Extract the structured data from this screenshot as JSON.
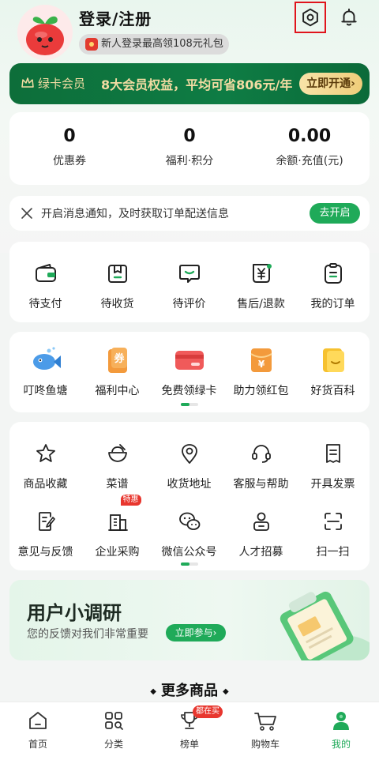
{
  "header": {
    "login_title": "登录/注册",
    "gift_text": "新人登录最高领108元礼包"
  },
  "vip": {
    "name": "绿卡会员",
    "desc": "8大会员权益，平均可省806元/年",
    "button": "立即开通›"
  },
  "stats": [
    {
      "value": "0",
      "label": "优惠券"
    },
    {
      "value": "0",
      "label": "福利·积分"
    },
    {
      "value": "0.00",
      "label": "余额·充值(元)"
    }
  ],
  "notice": {
    "text": "开启消息通知，及时获取订单配送信息",
    "button": "去开启"
  },
  "orders": [
    {
      "label": "待支付",
      "icon": "wallet-icon"
    },
    {
      "label": "待收货",
      "icon": "package-icon"
    },
    {
      "label": "待评价",
      "icon": "comment-icon"
    },
    {
      "label": "售后/退款",
      "icon": "refund-icon"
    },
    {
      "label": "我的订单",
      "icon": "order-list-icon"
    }
  ],
  "features": [
    {
      "label": "叮咚鱼塘",
      "icon": "fish-icon"
    },
    {
      "label": "福利中心",
      "icon": "coupon-icon"
    },
    {
      "label": "免费领绿卡",
      "icon": "card-icon"
    },
    {
      "label": "助力领红包",
      "icon": "red-packet-icon"
    },
    {
      "label": "好货百科",
      "icon": "book-icon"
    }
  ],
  "services": {
    "row1": [
      {
        "label": "商品收藏",
        "icon": "star-icon"
      },
      {
        "label": "菜谱",
        "icon": "bowl-icon"
      },
      {
        "label": "收货地址",
        "icon": "location-icon"
      },
      {
        "label": "客服与帮助",
        "icon": "headset-icon"
      },
      {
        "label": "开具发票",
        "icon": "invoice-icon"
      }
    ],
    "row2": [
      {
        "label": "意见与反馈",
        "icon": "feedback-icon"
      },
      {
        "label": "企业采购",
        "icon": "enterprise-icon",
        "badge": "特惠"
      },
      {
        "label": "微信公众号",
        "icon": "wechat-icon"
      },
      {
        "label": "人才招募",
        "icon": "recruit-icon"
      },
      {
        "label": "扫一扫",
        "icon": "scan-icon"
      }
    ]
  },
  "survey": {
    "title": "用户小调研",
    "subtitle": "您的反馈对我们非常重要",
    "button": "立即参与›"
  },
  "more_title": "更多商品",
  "tabbar": [
    {
      "label": "首页",
      "icon": "home-icon"
    },
    {
      "label": "分类",
      "icon": "category-icon"
    },
    {
      "label": "榜单",
      "icon": "trophy-icon",
      "badge": "都在买"
    },
    {
      "label": "购物车",
      "icon": "cart-icon"
    },
    {
      "label": "我的",
      "icon": "profile-icon",
      "active": true
    }
  ],
  "colors": {
    "brand_green": "#1faa59",
    "vip_green": "#0e7c44",
    "vip_gold": "#f3dca3",
    "badge_red": "#e8362e"
  }
}
